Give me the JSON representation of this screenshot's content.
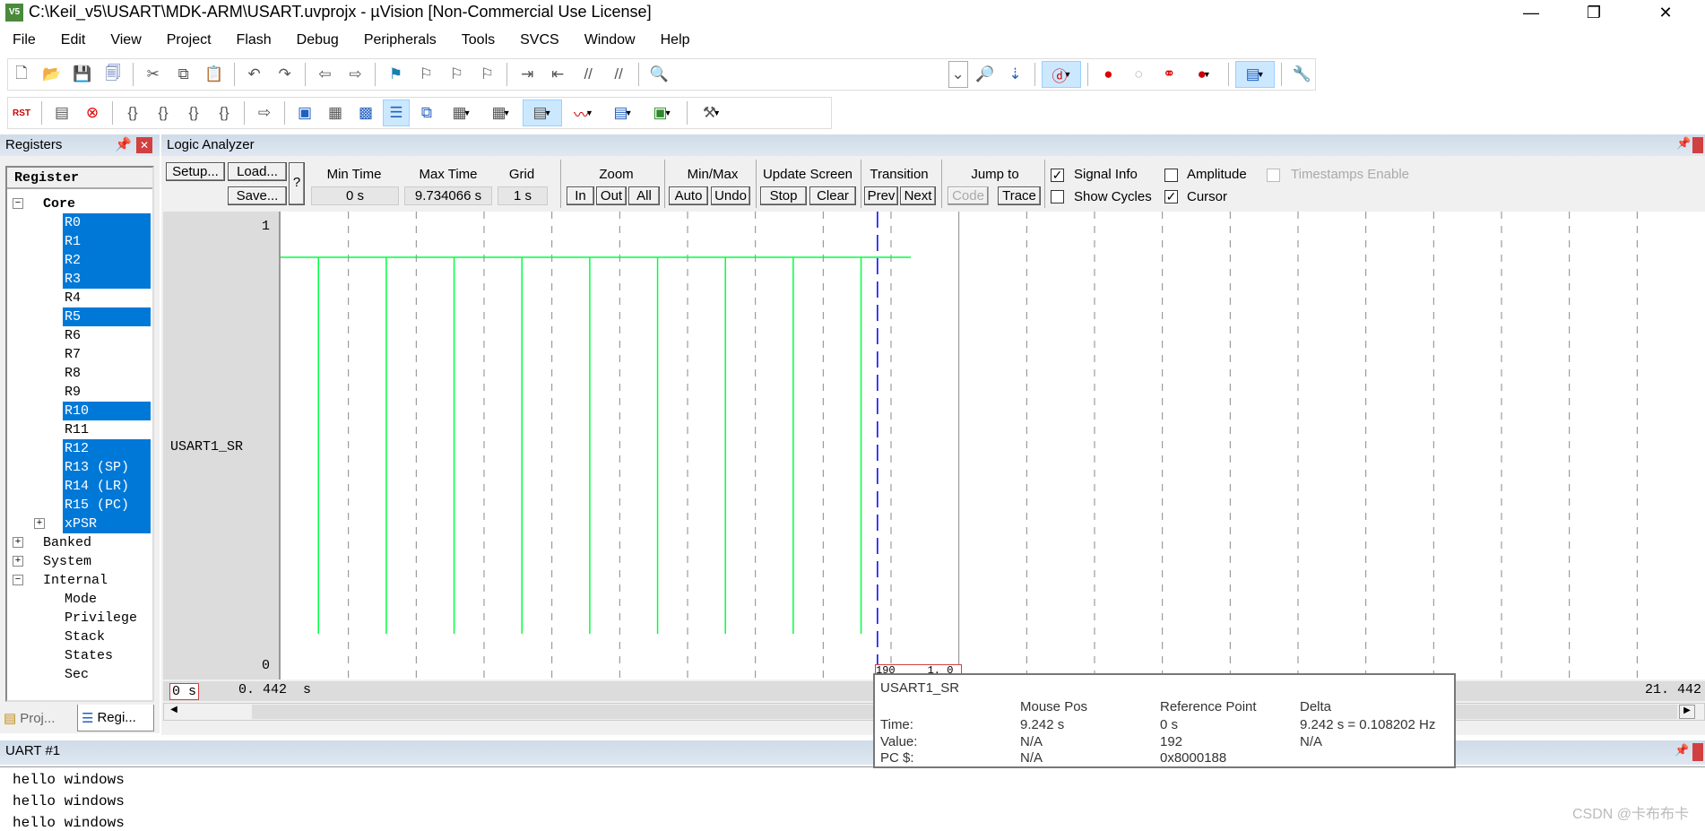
{
  "window": {
    "title": "C:\\Keil_v5\\USART\\MDK-ARM\\USART.uvprojx - µVision  [Non-Commercial Use License]",
    "icon": "keil-uv5-icon"
  },
  "menu": [
    "File",
    "Edit",
    "View",
    "Project",
    "Flash",
    "Debug",
    "Peripherals",
    "Tools",
    "SVCS",
    "Window",
    "Help"
  ],
  "registers": {
    "title": "Registers",
    "header": "Register",
    "core": "Core",
    "core_items": [
      {
        "label": "R0",
        "selected": true
      },
      {
        "label": "R1",
        "selected": true
      },
      {
        "label": "R2",
        "selected": true
      },
      {
        "label": "R3",
        "selected": true
      },
      {
        "label": "R4",
        "selected": false
      },
      {
        "label": "R5",
        "selected": true
      },
      {
        "label": "R6",
        "selected": false
      },
      {
        "label": "R7",
        "selected": false
      },
      {
        "label": "R8",
        "selected": false
      },
      {
        "label": "R9",
        "selected": false
      },
      {
        "label": "R10",
        "selected": true
      },
      {
        "label": "R11",
        "selected": false
      },
      {
        "label": "R12",
        "selected": true
      },
      {
        "label": "R13 (SP)",
        "selected": true
      },
      {
        "label": "R14 (LR)",
        "selected": true
      },
      {
        "label": "R15 (PC)",
        "selected": true
      },
      {
        "label": "xPSR",
        "selected": true
      }
    ],
    "groups": [
      "Banked",
      "System",
      "Internal"
    ],
    "internal_items": [
      "Mode",
      "Privilege",
      "Stack",
      "States",
      "Sec"
    ],
    "tabs": [
      "Proj...",
      "Regi..."
    ]
  },
  "logic_analyzer": {
    "title": "Logic Analyzer",
    "setup": "Setup...",
    "load": "Load...",
    "save": "Save...",
    "help": "?",
    "min_time_label": "Min Time",
    "min_time": "0 s",
    "max_time_label": "Max Time",
    "max_time": "9.734066 s",
    "grid_label": "Grid",
    "grid": "1 s",
    "zoom_label": "Zoom",
    "zoom_in": "In",
    "zoom_out": "Out",
    "zoom_all": "All",
    "minmax_label": "Min/Max",
    "auto": "Auto",
    "undo": "Undo",
    "update_label": "Update Screen",
    "stop": "Stop",
    "clear": "Clear",
    "transition_label": "Transition",
    "prev": "Prev",
    "next": "Next",
    "jump_label": "Jump to",
    "code": "Code",
    "trace": "Trace",
    "signal_info": {
      "label": "Signal Info",
      "checked": true
    },
    "amplitude": {
      "label": "Amplitude",
      "checked": false
    },
    "timestamps": {
      "label": "Timestamps Enable",
      "checked": false,
      "disabled": true
    },
    "show_cycles": {
      "label": "Show Cycles",
      "checked": false
    },
    "cursor": {
      "label": "Cursor",
      "checked": true
    },
    "signal_name": "USART1_SR",
    "y_max": "1",
    "y_min": "0",
    "time_start_box": "0 s",
    "time_left": "0. 442  s",
    "time_right": "21. 442",
    "cursor_value_box": "190     1. 0"
  },
  "waveform": {
    "t_start": 0.442,
    "t_end": 21.442,
    "grid_s": 1,
    "pulse_times_s": [
      1,
      2,
      3,
      4,
      5,
      6,
      7,
      8,
      9
    ],
    "high_until_s": 9.734066,
    "cursor_s": 9.242,
    "colors": {
      "signal": "#00ff40",
      "cursor": "#0000ff",
      "grid": "#888888"
    }
  },
  "tooltip": {
    "signal": "USART1_SR",
    "headers": [
      "Mouse Pos",
      "Reference Point",
      "Delta"
    ],
    "rows": [
      {
        "label": "Time:",
        "mouse": "9.242 s",
        "ref": "0 s",
        "delta": "9.242 s = 0.108202 Hz"
      },
      {
        "label": "Value:",
        "mouse": "N/A",
        "ref": "192",
        "delta": "N/A"
      },
      {
        "label": "PC $:",
        "mouse": "N/A",
        "ref": "0x8000188",
        "delta": ""
      }
    ]
  },
  "uart": {
    "title": "UART #1",
    "lines": [
      "hello windows",
      "hello windows",
      "hello windows"
    ]
  },
  "watermark": "CSDN @卡布布卡"
}
